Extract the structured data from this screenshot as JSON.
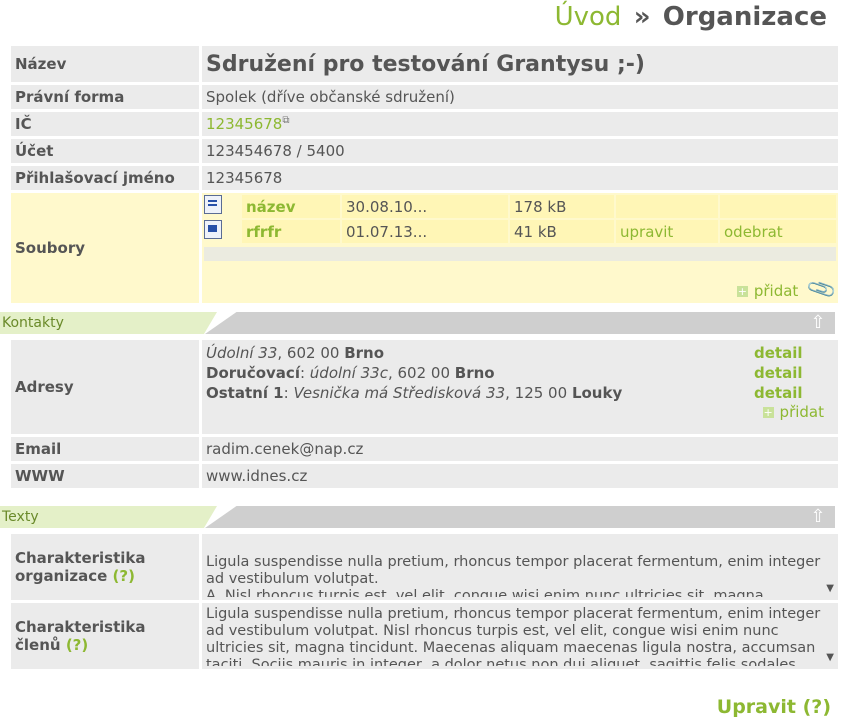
{
  "breadcrumb": {
    "home": "Úvod",
    "separator": "»",
    "current": "Organizace"
  },
  "org": {
    "labels": {
      "name": "Název",
      "legal_form": "Právní forma",
      "ic": "IČ",
      "account": "Účet",
      "login": "Přihlašovací jméno",
      "files": "Soubory"
    },
    "name": "Sdružení pro testování Grantysu ;-)",
    "legal_form": "Spolek (dříve občanské sdružení)",
    "ic": "12345678",
    "account": "123454678 / 5400",
    "login": "12345678"
  },
  "files": [
    {
      "icon": "word-document-icon",
      "name": "název",
      "date": "30.08.10...",
      "size": "178 kB",
      "edit": "",
      "remove": ""
    },
    {
      "icon": "spreadsheet-icon",
      "name": "rfrfr",
      "date": "01.07.13...",
      "size": "41 kB",
      "edit": "upravit",
      "remove": "odebrat"
    }
  ],
  "files_add_label": "přidat",
  "contacts": {
    "header": "Kontakty",
    "labels": {
      "addresses": "Adresy",
      "email": "Email",
      "www": "WWW"
    },
    "addresses": [
      {
        "type": "",
        "street": "Údolní 33",
        "zip": "602 00",
        "city": "Brno",
        "detail": "detail"
      },
      {
        "type": "Doručovací",
        "street": "údolní 33c",
        "zip": "602 00",
        "city": "Brno",
        "detail": "detail"
      },
      {
        "type": "Ostatní 1",
        "street": "Vesnička má Středisková 33",
        "zip": "125 00",
        "city": "Louky",
        "detail": "detail"
      }
    ],
    "add_label": "přidat",
    "email": "radim.cenek@nap.cz",
    "www": "www.idnes.cz"
  },
  "texts": {
    "header": "Texty",
    "org_char_label": "Charakteristika organizace",
    "members_char_label": "Charakteristika členů",
    "help": "(?)",
    "org_char_text": "Ligula suspendisse nulla pretium, rhoncus tempor placerat fermentum, enim integer ad vestibulum volutpat.\nA. Nisl rhoncus turpis est, vel elit, congue wisi enim nunc ultricies sit, magna tincidunt.\nB. Maecenas aliquam maecenas ligula nostra, accumsan taciti. Sociis mauris in",
    "members_char_text": "Ligula suspendisse nulla pretium, rhoncus tempor placerat fermentum, enim integer ad vestibulum volutpat. Nisl rhoncus turpis est, vel elit, congue wisi enim nunc ultricies sit, magna tincidunt. Maecenas aliquam maecenas ligula nostra, accumsan taciti. Sociis mauris in integer, a dolor netus non dui aliquet, sagittis felis sodales"
  },
  "edit_label": "Upravit",
  "edit_help": "(?)",
  "colors": {
    "accent": "#8db832",
    "label_bg": "#ebebeb",
    "files_bg": "#fff9cc",
    "section_bar": "#cfcfcf"
  }
}
